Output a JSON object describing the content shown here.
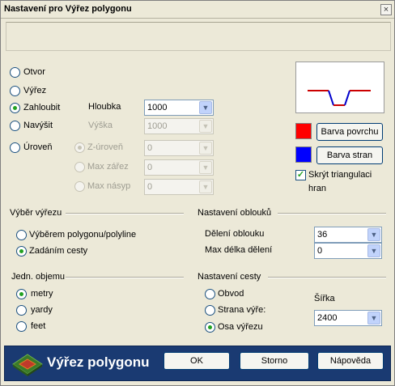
{
  "window": {
    "title": "Nastavení pro Výřez polygonu",
    "close": "×"
  },
  "mode": {
    "options": [
      {
        "label": "Otvor",
        "checked": false
      },
      {
        "label": "Výřez",
        "checked": false
      },
      {
        "label": "Zahloubit",
        "checked": true
      },
      {
        "label": "Navýšit",
        "checked": false
      },
      {
        "label": "Úroveň",
        "checked": false
      }
    ],
    "hloubka_label": "Hloubka",
    "hloubka_value": "1000",
    "vyska_label": "Výška",
    "vyska_value": "1000",
    "sub_options": [
      {
        "label": "Z-úroveň",
        "value": "0",
        "checked": true
      },
      {
        "label": "Max zářez",
        "value": "0",
        "checked": false
      },
      {
        "label": "Max násyp",
        "value": "0",
        "checked": false
      }
    ]
  },
  "colors": {
    "surface_color": "#ff0000",
    "sides_color": "#0000ff",
    "surface_button": "Barva povrchu",
    "sides_button": "Barva stran",
    "hide_triangulation_label_1": "Skrýt triangulaci",
    "hide_triangulation_label_2": "hran",
    "hide_triangulation_checked": true
  },
  "selection": {
    "heading": "Výběr výřezu",
    "options": [
      {
        "label": "Výběrem polygonu/polyline",
        "checked": false
      },
      {
        "label": "Zadáním cesty",
        "checked": true
      }
    ]
  },
  "arcs": {
    "heading": "Nastavení oblouků",
    "division_label": "Dělení oblouku",
    "division_value": "36",
    "max_length_label": "Max délka dělení",
    "max_length_value": "0"
  },
  "units": {
    "heading": "Jedn. objemu",
    "options": [
      {
        "label": "metry",
        "checked": true
      },
      {
        "label": "yardy",
        "checked": false
      },
      {
        "label": "feet",
        "checked": false
      }
    ]
  },
  "path": {
    "heading": "Nastavení cesty",
    "options": [
      {
        "label": "Obvod",
        "checked": false
      },
      {
        "label": "Strana výře:",
        "checked": false
      },
      {
        "label": "Osa výřezu",
        "checked": true
      }
    ],
    "width_label": "Šířka",
    "width_value": "2400"
  },
  "footer": {
    "title": "Výřez polygonu",
    "ok": "OK",
    "cancel": "Storno",
    "help": "Nápověda"
  }
}
